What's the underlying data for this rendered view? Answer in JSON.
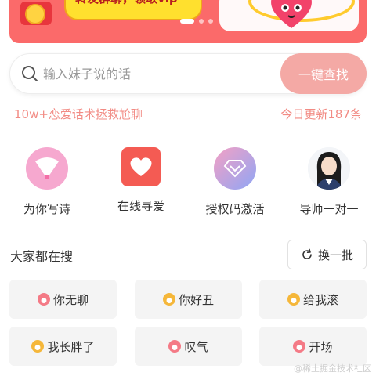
{
  "banner": {
    "text": "转发群聊，领取vip",
    "slide_count": 3,
    "active_slide": 1
  },
  "search": {
    "placeholder": "输入妹子说的话",
    "button_label": "一键查找"
  },
  "subheader": {
    "left": "10w+恋爱话术拯救尬聊",
    "right": "今日更新187条"
  },
  "quick_actions": [
    {
      "label": "为你写诗",
      "icon": "fan-icon"
    },
    {
      "label": "在线寻爱",
      "icon": "heart-icon"
    },
    {
      "label": "授权码激活",
      "icon": "diamond-icon"
    },
    {
      "label": "导师一对一",
      "icon": "mentor-avatar"
    }
  ],
  "hot_search": {
    "title": "大家都在搜",
    "refresh_label": "换一批",
    "tags": [
      {
        "label": "你无聊",
        "icon": "flame-icon"
      },
      {
        "label": "你好丑",
        "icon": "flame-icon"
      },
      {
        "label": "给我滚",
        "icon": "flame-icon"
      },
      {
        "label": "我长胖了",
        "icon": "flame-icon"
      },
      {
        "label": "叹气",
        "icon": "flame-icon"
      },
      {
        "label": "开场",
        "icon": "flame-icon"
      }
    ]
  },
  "watermark": "@稀土掘金技术社区",
  "colors": {
    "accent": "#f4a9a5",
    "banner": "#fb6a6a",
    "subtext": "#f28b84",
    "tag_bg": "#f4f4f4"
  }
}
